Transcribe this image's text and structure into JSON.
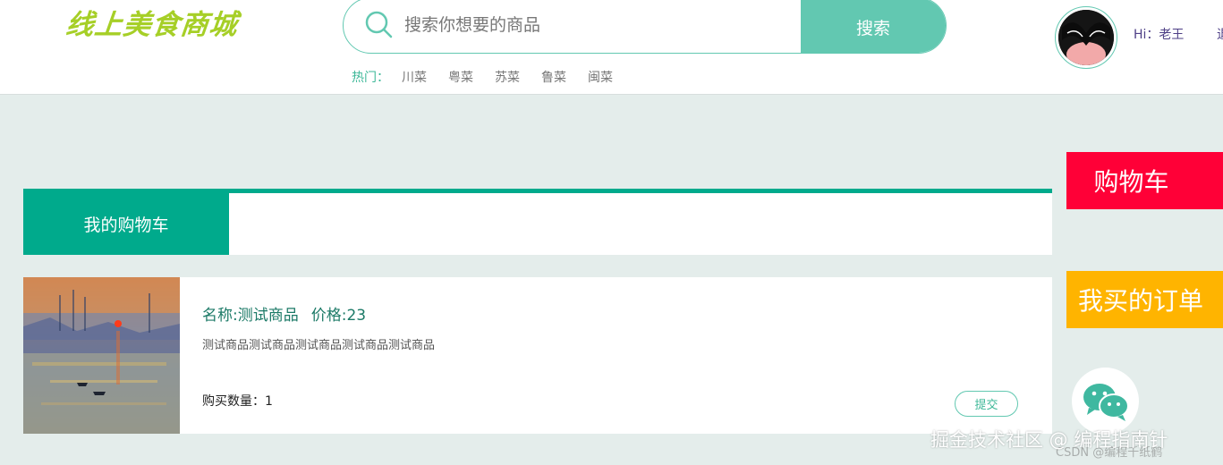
{
  "header": {
    "logo_text": "线上美食商城",
    "search": {
      "placeholder": "搜索你想要的商品",
      "button_label": "搜索"
    },
    "hot": {
      "label": "热门：",
      "items": [
        "川菜",
        "粤菜",
        "苏菜",
        "鲁菜",
        "闽菜"
      ]
    },
    "user": {
      "greeting": "Hi：老王",
      "extra": "退"
    }
  },
  "cart": {
    "tab_label": "我的购物车"
  },
  "product": {
    "name": "名称:测试商品",
    "price": "价格:23",
    "description": "测试商品测试商品测试商品测试商品测试商品",
    "quantity_label": "购买数量：",
    "quantity_value": "1",
    "submit_label": "提交"
  },
  "side": {
    "cart_label": "购物车",
    "orders_label": "我买的订单"
  },
  "watermark": {
    "main": "掘金技术社区 @ 编程指南针",
    "sub": "CSDN @编程千纸鹤"
  },
  "colors": {
    "accent": "#00aa8c",
    "search_accent": "#62c8b1",
    "side_cart": "#ff0037",
    "side_orders": "#ffb400",
    "page_bg": "#e4edeb"
  },
  "icons": {
    "search": "search-icon",
    "wechat": "wechat-icon",
    "avatar": "avatar-image",
    "product": "product-image"
  }
}
